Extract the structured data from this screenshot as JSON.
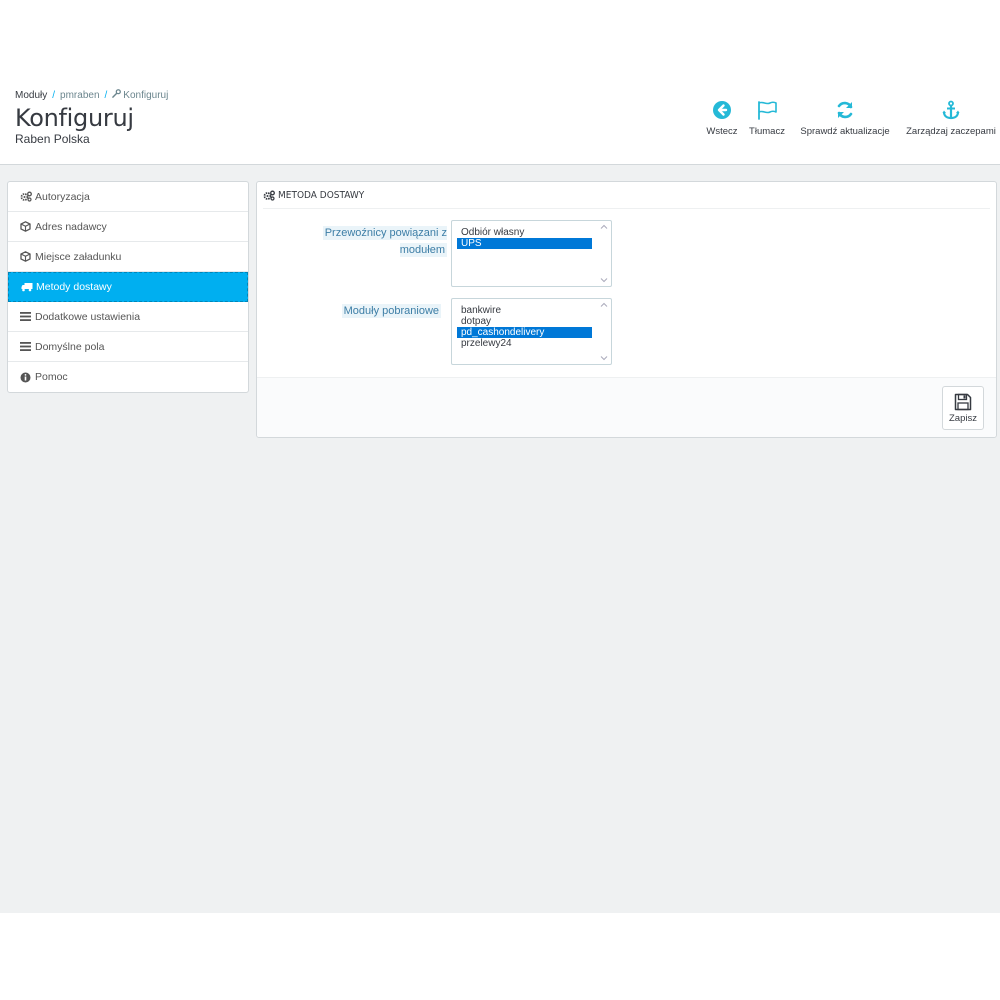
{
  "breadcrumb": {
    "items": [
      "Moduły",
      "pmraben",
      "Konfiguruj"
    ],
    "separator": "/"
  },
  "header": {
    "title": "Konfiguruj",
    "subtitle": "Raben Polska"
  },
  "toolbar": {
    "back_label": "Wstecz",
    "translate_label": "Tłumacz",
    "check_updates_label": "Sprawdź aktualizacje",
    "manage_hooks_label": "Zarządzaj zaczepami"
  },
  "sidebar": {
    "items": [
      {
        "label": "Autoryzacja",
        "icon": "cogs-icon",
        "active": false
      },
      {
        "label": "Adres nadawcy",
        "icon": "cube-icon",
        "active": false
      },
      {
        "label": "Miejsce załadunku",
        "icon": "cube-icon",
        "active": false
      },
      {
        "label": "Metody dostawy",
        "icon": "truck-icon",
        "active": true
      },
      {
        "label": "Dodatkowe ustawienia",
        "icon": "list-icon",
        "active": false
      },
      {
        "label": "Domyślne pola",
        "icon": "list-icon",
        "active": false
      },
      {
        "label": "Pomoc",
        "icon": "info-circle-icon",
        "active": false
      }
    ]
  },
  "panel": {
    "heading": "METODA DOSTAWY",
    "carriers": {
      "label": "Przewoźnicy powiązani z modułem",
      "options": [
        {
          "label": "Odbiór własny",
          "selected": false
        },
        {
          "label": "UPS",
          "selected": true
        }
      ]
    },
    "cod_modules": {
      "label": "Moduły pobraniowe",
      "options": [
        {
          "label": "bankwire",
          "selected": false
        },
        {
          "label": "dotpay",
          "selected": false
        },
        {
          "label": "pd_cashondelivery",
          "selected": true
        },
        {
          "label": "przelewy24",
          "selected": false
        }
      ]
    },
    "save_label": "Zapisz"
  },
  "colors": {
    "accent": "#00aff0",
    "icon_blue": "#25b9d7",
    "selection": "#0078d7",
    "background": "#eff1f2"
  }
}
